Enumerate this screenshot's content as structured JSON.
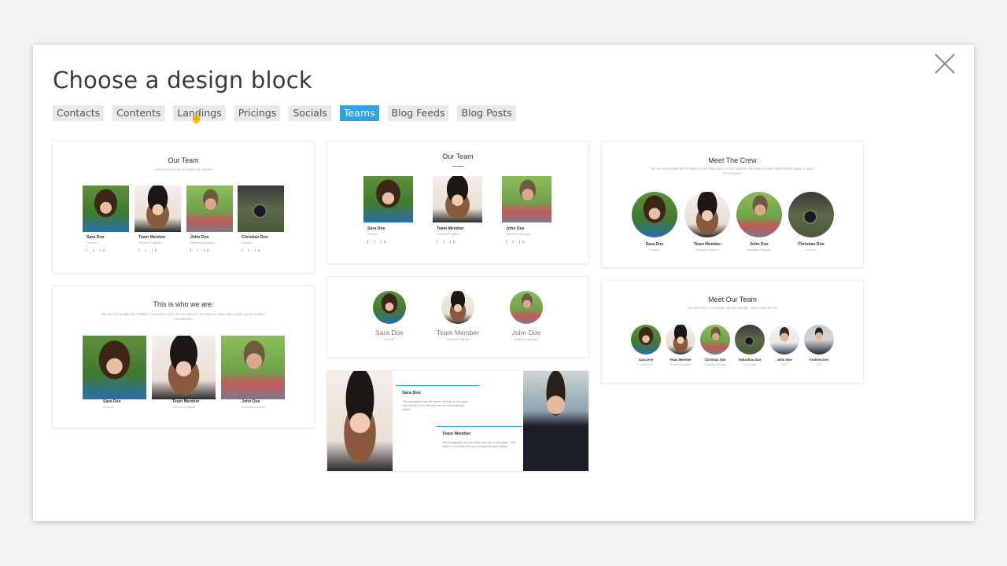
{
  "modal": {
    "title": "Choose a design block",
    "tabs": [
      "Contacts",
      "Contents",
      "Landings",
      "Pricings",
      "Socials",
      "Teams",
      "Blog Feeds",
      "Blog Posts"
    ],
    "active_tab": "Teams"
  },
  "blocks": {
    "b1": {
      "title": "Our Team",
      "subtitle": "Let's put some faces behind the names",
      "members": [
        {
          "name": "Sara Doe",
          "role": "Founder"
        },
        {
          "name": "Team Member",
          "role": "Software Engineer"
        },
        {
          "name": "John Doe",
          "role": "Marketing Manager"
        },
        {
          "name": "Christian Doe",
          "role": "Founder"
        }
      ],
      "social": "f  t  in"
    },
    "b2": {
      "title": "Our Team",
      "members": [
        {
          "name": "Sara Doe",
          "role": "Founder"
        },
        {
          "name": "Team Member",
          "role": "Software Engineer"
        },
        {
          "name": "John Doe",
          "role": "Marketing Manager"
        }
      ],
      "social": "f  t  in"
    },
    "b3": {
      "title": "Meet The Crew",
      "subtitle": "We are real people and Frisala is more than a job, it's our passion. We want to make web a better place, a place for everyone",
      "members": [
        {
          "name": "Sara Doe",
          "role": "Founder"
        },
        {
          "name": "Team Member",
          "role": "Software Engineer"
        },
        {
          "name": "John Doe",
          "role": "Marketing Manager"
        },
        {
          "name": "Christian Doe",
          "role": "Founder"
        }
      ]
    },
    "b4": {
      "title": "This is who we are.",
      "subtitle": "We are real people and Frisala is more than a job, it's our passion. We want to make web a better place, a place for everyone",
      "members": [
        {
          "name": "Sara Doe",
          "role": "Founder"
        },
        {
          "name": "Team Member",
          "role": "Software Engineer"
        },
        {
          "name": "John Doe",
          "role": "Marketing Manager"
        }
      ]
    },
    "b5": {
      "members": [
        {
          "name": "Sara Doe",
          "role": "Founder"
        },
        {
          "name": "Team Member",
          "role": "Software Engineer"
        },
        {
          "name": "John Doe",
          "role": "Marketing Manager"
        }
      ]
    },
    "b6": {
      "title": "Meet Our Team",
      "subtitle": "You don't hire a company, you hire people. This is who we are",
      "members": [
        {
          "name": "Sara Doe",
          "role": "Co-Founder"
        },
        {
          "name": "Team Member",
          "role": "Software Engineer"
        },
        {
          "name": "Christian Doe",
          "role": "Marketing Manager"
        },
        {
          "name": "Sebastian Doe",
          "role": "Co-Founder"
        },
        {
          "name": "John Doe",
          "role": "CEO"
        },
        {
          "name": "Andrew Doe",
          "role": "CTO"
        }
      ]
    },
    "b7": {
      "members": [
        {
          "name": "Sara Doe",
          "text": "This paragraph can be edited directly on the page. Just click in it and the text can be automatically edited."
        },
        {
          "name": "Team Member",
          "text": "This paragraph can be edited directly on the page. Just click in it and the text can be automatically edited."
        }
      ]
    }
  }
}
